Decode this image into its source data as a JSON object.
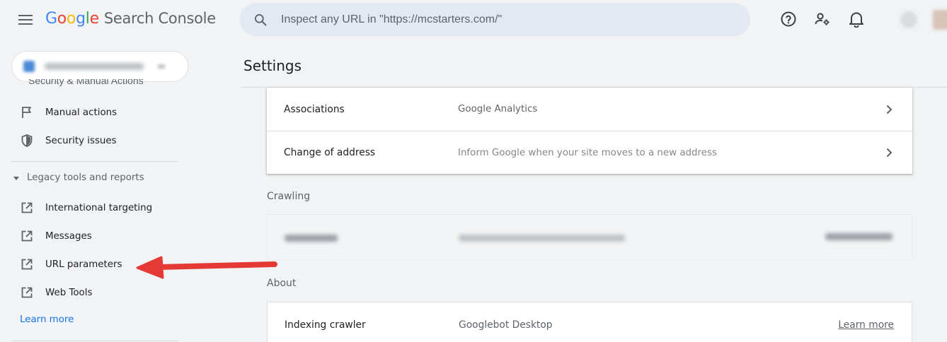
{
  "header": {
    "logo_letters": [
      {
        "ch": "G",
        "color": "#4285f4"
      },
      {
        "ch": "o",
        "color": "#ea4335"
      },
      {
        "ch": "o",
        "color": "#fbbc05"
      },
      {
        "ch": "g",
        "color": "#4285f4"
      },
      {
        "ch": "l",
        "color": "#34a853"
      },
      {
        "ch": "e",
        "color": "#ea4335"
      }
    ],
    "product_name": "Search Console",
    "search_placeholder": "Inspect any URL in \"https://mcstarters.com/\"",
    "icons": [
      "menu-icon",
      "search-icon",
      "help-icon",
      "manage-users-icon",
      "notifications-icon"
    ]
  },
  "sidebar": {
    "partial_item": "Security & Manual Actions",
    "items": [
      {
        "label": "Manual actions",
        "icon": "flag-icon"
      },
      {
        "label": "Security issues",
        "icon": "shield-icon"
      }
    ],
    "legacy_header": "Legacy tools and reports",
    "legacy_items": [
      {
        "label": "International targeting",
        "icon": "external-link-icon"
      },
      {
        "label": "Messages",
        "icon": "external-link-icon"
      },
      {
        "label": "URL parameters",
        "icon": "external-link-icon"
      },
      {
        "label": "Web Tools",
        "icon": "external-link-icon"
      }
    ],
    "learn_more": "Learn more"
  },
  "main": {
    "title": "Settings",
    "general_rows": [
      {
        "name": "Associations",
        "desc": "Google Analytics"
      },
      {
        "name": "Change of address",
        "desc": "Inform Google when your site moves to a new address"
      }
    ],
    "crawling_label": "Crawling",
    "about_label": "About",
    "about_row": {
      "name": "Indexing crawler",
      "value": "Googlebot Desktop",
      "link": "Learn more"
    }
  },
  "colors": {
    "background": "#f1f3f4",
    "accent": "#1a73e8",
    "annotation_arrow": "#e53935"
  }
}
